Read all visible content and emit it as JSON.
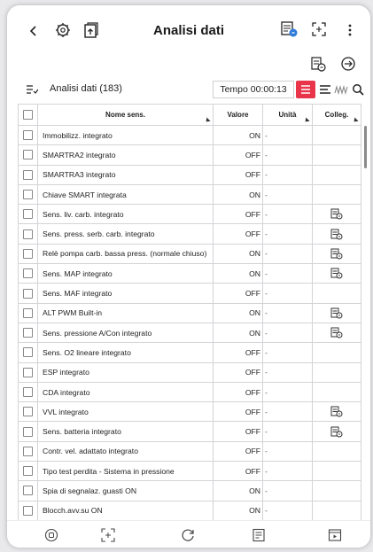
{
  "header": {
    "title": "Analisi dati",
    "back_icon": "chevron-left-icon",
    "accent_color": "#e8354a"
  },
  "toolbar": {
    "list_label": "Analisi dati (183)",
    "timer": "Tempo 00:00:13"
  },
  "table": {
    "columns": {
      "name": "Nome sens.",
      "value": "Valore",
      "unit": "Unità",
      "link": "Colleg."
    },
    "rows": [
      {
        "name": "Immobilizz. integrato",
        "value": "ON",
        "unit": "-",
        "linked": false
      },
      {
        "name": "SMARTRA2 integrato",
        "value": "OFF",
        "unit": "-",
        "linked": false
      },
      {
        "name": "SMARTRA3 integrato",
        "value": "OFF",
        "unit": "-",
        "linked": false
      },
      {
        "name": "Chiave SMART integrata",
        "value": "ON",
        "unit": "-",
        "linked": false
      },
      {
        "name": "Sens. liv. carb. integrato",
        "value": "OFF",
        "unit": "-",
        "linked": true
      },
      {
        "name": "Sens. press. serb. carb. integrato",
        "value": "OFF",
        "unit": "-",
        "linked": true
      },
      {
        "name": "Relè pompa carb. bassa press. (normale chiuso)",
        "value": "ON",
        "unit": "-",
        "linked": true
      },
      {
        "name": "Sens. MAP integrato",
        "value": "ON",
        "unit": "-",
        "linked": true
      },
      {
        "name": "Sens. MAF integrato",
        "value": "OFF",
        "unit": "-",
        "linked": false
      },
      {
        "name": "ALT PWM Built-in",
        "value": "ON",
        "unit": "-",
        "linked": true
      },
      {
        "name": "Sens. pressione A/Con integrato",
        "value": "ON",
        "unit": "-",
        "linked": true
      },
      {
        "name": "Sens. O2 lineare integrato",
        "value": "OFF",
        "unit": "-",
        "linked": false
      },
      {
        "name": "ESP integrato",
        "value": "OFF",
        "unit": "-",
        "linked": false
      },
      {
        "name": "CDA integrato",
        "value": "OFF",
        "unit": "-",
        "linked": false
      },
      {
        "name": "VVL integrato",
        "value": "OFF",
        "unit": "-",
        "linked": true
      },
      {
        "name": "Sens. batteria integrato",
        "value": "OFF",
        "unit": "-",
        "linked": true
      },
      {
        "name": "Contr. vel. adattato integrato",
        "value": "OFF",
        "unit": "-",
        "linked": false
      },
      {
        "name": "Tipo test perdita - Sistema in pressione",
        "value": "OFF",
        "unit": "-",
        "linked": false
      },
      {
        "name": "Spia di segnalaz. guasti ON",
        "value": "ON",
        "unit": "-",
        "linked": false
      },
      {
        "name": "Blocch.avv.su ON",
        "value": "ON",
        "unit": "-",
        "linked": false
      }
    ]
  },
  "bottom_nav": {
    "items": [
      "home-icon",
      "fit-screen-icon",
      "refresh-icon",
      "report-icon",
      "play-icon"
    ]
  }
}
